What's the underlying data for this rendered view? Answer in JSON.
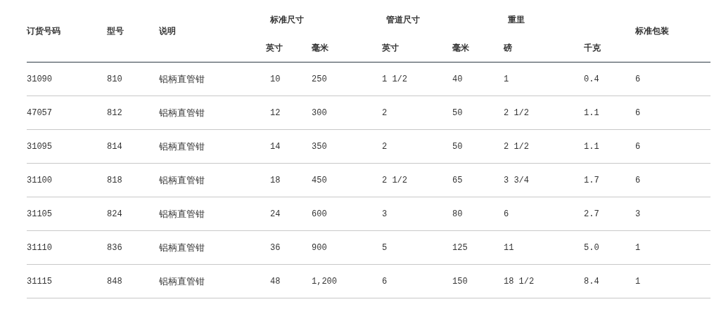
{
  "table": {
    "header": [
      {
        "kind": "single",
        "label": "订货号码"
      },
      {
        "kind": "single",
        "label": "型号"
      },
      {
        "kind": "single",
        "label": "说明"
      },
      {
        "kind": "group",
        "label": "标准尺寸",
        "children": [
          "英寸",
          "毫米"
        ]
      },
      {
        "kind": "group",
        "label": "管道尺寸",
        "children": [
          "英寸",
          "毫米"
        ]
      },
      {
        "kind": "group",
        "label": "重里",
        "children": [
          "磅",
          "千克"
        ]
      },
      {
        "kind": "single",
        "label": "标准包装"
      }
    ],
    "rows": [
      [
        "31090",
        "810",
        "铝柄直管钳",
        "10",
        "250",
        "1 1/2",
        "40",
        "1",
        "0.4",
        "6"
      ],
      [
        "47057",
        "812",
        "铝柄直管钳",
        "12",
        "300",
        "2",
        "50",
        "2 1/2",
        "1.1",
        "6"
      ],
      [
        "31095",
        "814",
        "铝柄直管钳",
        "14",
        "350",
        "2",
        "50",
        "2 1/2",
        "1.1",
        "6"
      ],
      [
        "31100",
        "818",
        "铝柄直管钳",
        "18",
        "450",
        "2 1/2",
        "65",
        "3 3/4",
        "1.7",
        "6"
      ],
      [
        "31105",
        "824",
        "铝柄直管钳",
        "24",
        "600",
        "3",
        "80",
        "6",
        "2.7",
        "3"
      ],
      [
        "31110",
        "836",
        "铝柄直管钳",
        "36",
        "900",
        "5",
        "125",
        "11",
        "5.0",
        "1"
      ],
      [
        "31115",
        "848",
        "铝柄直管钳",
        "48",
        "1,200",
        "6",
        "150",
        "18 1/2",
        "8.4",
        "1"
      ]
    ]
  }
}
